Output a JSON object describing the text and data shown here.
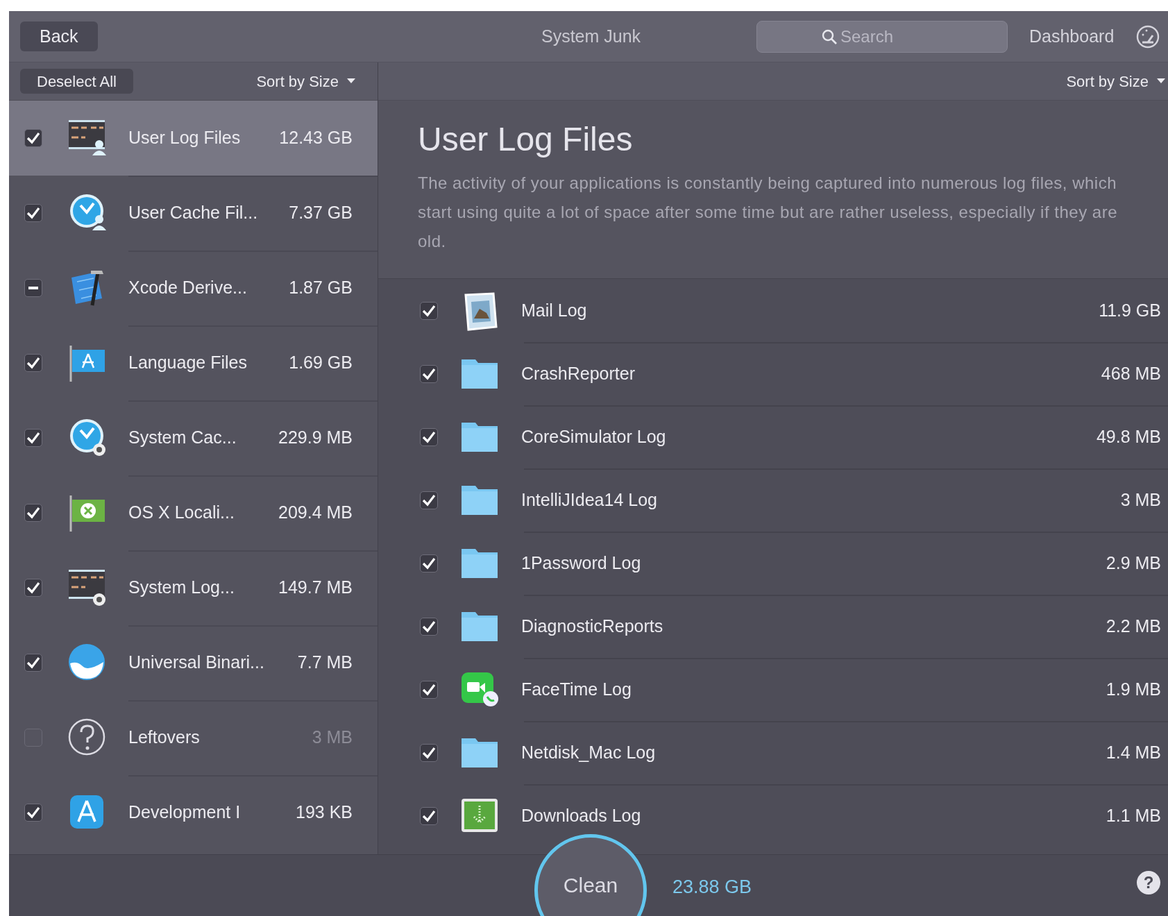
{
  "toolbar": {
    "back": "Back",
    "title": "System Junk",
    "search": {
      "placeholder": "Search"
    },
    "dashboard": "Dashboard"
  },
  "left": {
    "deselect": "Deselect All",
    "sort": "Sort by Size",
    "items": [
      {
        "kind": "log-user",
        "name": "User Log Files",
        "size": "12.43 GB",
        "checked": true,
        "partial": false,
        "selected": true
      },
      {
        "kind": "clock-user",
        "name": "User Cache Fil...",
        "size": "7.37 GB",
        "checked": true,
        "partial": false,
        "selected": false
      },
      {
        "kind": "xcode",
        "name": "Xcode Derive...",
        "size": "1.87 GB",
        "checked": true,
        "partial": true,
        "selected": false
      },
      {
        "kind": "flag-blue",
        "name": "Language Files",
        "size": "1.69 GB",
        "checked": true,
        "partial": false,
        "selected": false
      },
      {
        "kind": "clock-gear",
        "name": "System Cac...",
        "size": "229.9 MB",
        "checked": true,
        "partial": false,
        "selected": false
      },
      {
        "kind": "flag-green",
        "name": "OS X Locali...",
        "size": "209.4 MB",
        "checked": true,
        "partial": false,
        "selected": false
      },
      {
        "kind": "log-gear",
        "name": "System Log...",
        "size": "149.7 MB",
        "checked": true,
        "partial": false,
        "selected": false
      },
      {
        "kind": "swirl",
        "name": "Universal Binari...",
        "size": "7.7 MB",
        "checked": true,
        "partial": false,
        "selected": false
      },
      {
        "kind": "question",
        "name": "Leftovers",
        "size": "3 MB",
        "checked": false,
        "partial": false,
        "selected": false
      },
      {
        "kind": "app",
        "name": "Development I",
        "size": "193 KB",
        "checked": true,
        "partial": false,
        "selected": false
      }
    ]
  },
  "detail": {
    "sort": "Sort by Size",
    "title": "User Log Files",
    "description": "The activity of your applications is constantly being captured into numerous log files, which start using quite a lot of space after some time but are rather useless, especially if they are old.",
    "rows": [
      {
        "kind": "mail",
        "name": "Mail Log",
        "size": "11.9 GB",
        "checked": true
      },
      {
        "kind": "folder",
        "name": "CrashReporter",
        "size": "468 MB",
        "checked": true
      },
      {
        "kind": "folder",
        "name": "CoreSimulator Log",
        "size": "49.8 MB",
        "checked": true
      },
      {
        "kind": "folder",
        "name": "IntelliJIdea14 Log",
        "size": "3 MB",
        "checked": true
      },
      {
        "kind": "folder",
        "name": "1Password Log",
        "size": "2.9 MB",
        "checked": true
      },
      {
        "kind": "folder",
        "name": "DiagnosticReports",
        "size": "2.2 MB",
        "checked": true
      },
      {
        "kind": "facetime",
        "name": "FaceTime Log",
        "size": "1.9 MB",
        "checked": true
      },
      {
        "kind": "folder",
        "name": "Netdisk_Mac Log",
        "size": "1.4 MB",
        "checked": true
      },
      {
        "kind": "downloads",
        "name": "Downloads Log",
        "size": "1.1 MB",
        "checked": true
      }
    ]
  },
  "footer": {
    "clean": "Clean",
    "total": "23.88 GB",
    "help": "?"
  }
}
